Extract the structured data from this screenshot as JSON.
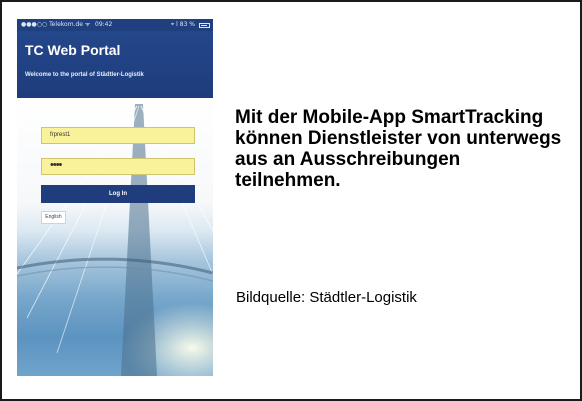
{
  "phone": {
    "status": {
      "carrier": "●●●○○ Telekom.de ᯤ",
      "time": "09:42",
      "battery": "⌖ ⅼ 83 %"
    },
    "portal_title": "TC Web Portal",
    "welcome": "Welcome to the portal of Städtler-Logistik",
    "username_value": "frprest1",
    "password_value": "••••",
    "login_label": "Log In",
    "language_label": "English"
  },
  "caption": {
    "text": "Mit der Mobile-App SmartTracking können Dienstleister von unterwegs aus an Ausschreibungen teilnehmen.",
    "source": "Bildquelle: Städtler-Logistik"
  },
  "colors": {
    "portal_blue": "#1f3f7e",
    "field_yellow": "#faf29a",
    "sky_blue": "#5f97c6"
  }
}
